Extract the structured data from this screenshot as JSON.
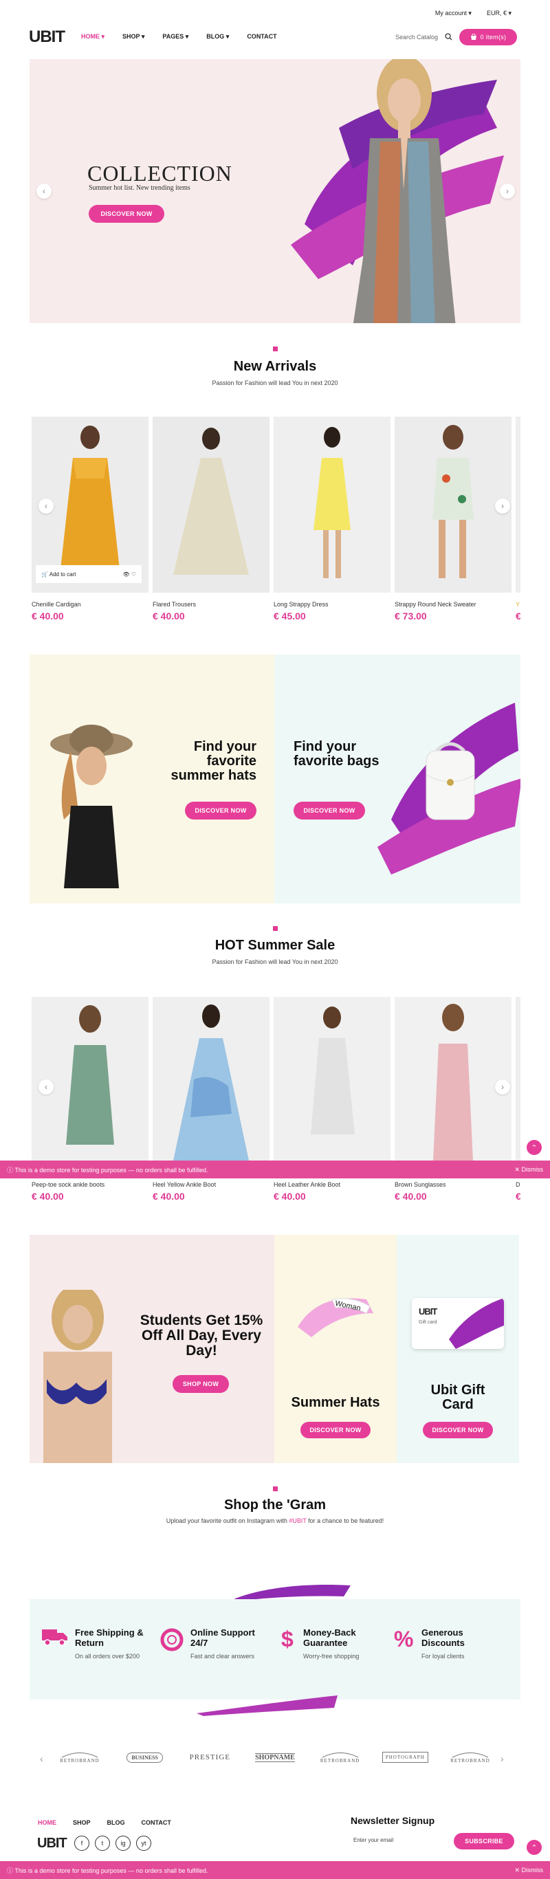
{
  "header": {
    "my_account": "My account",
    "currency": "EUR, €",
    "logo": "UBIT",
    "nav": [
      "HOME",
      "SHOP",
      "PAGES",
      "BLOG",
      "CONTACT"
    ],
    "search_placeholder": "Search Catalog",
    "cart_label": "0 item(s)"
  },
  "hero": {
    "title": "COLLECTION",
    "subtitle": "Summer hot list. New trending items",
    "button": "DISCOVER NOW"
  },
  "new_arrivals": {
    "title": "New Arrivals",
    "subtitle": "Passion for Fashion will lead You in next 2020",
    "add_to_cart": "Add to cart",
    "products": [
      {
        "name": "Chenille Cardigan",
        "price": "€ 40.00"
      },
      {
        "name": "Flared Trousers",
        "price": "€ 40.00"
      },
      {
        "name": "Long Strappy Dress",
        "price": "€ 45.00"
      },
      {
        "name": "Strappy Round Neck Sweater",
        "price": "€ 73.00"
      },
      {
        "name": "Y",
        "price": "€"
      }
    ]
  },
  "banners": {
    "hats": {
      "title": "Find your favorite summer hats",
      "button": "DISCOVER NOW"
    },
    "bags": {
      "title": "Find your favorite bags",
      "button": "DISCOVER NOW"
    }
  },
  "hot_sale": {
    "title": "HOT Summer Sale",
    "subtitle": "Passion for Fashion will lead You in next 2020",
    "products": [
      {
        "name": "Peep-toe sock ankle boots",
        "price": "€ 40.00"
      },
      {
        "name": "Heel Yellow Ankle Boot",
        "price": "€ 40.00"
      },
      {
        "name": "Heel Leather Ankle Boot",
        "price": "€ 40.00"
      },
      {
        "name": "Brown Sunglasses",
        "price": "€ 40.00"
      },
      {
        "name": "D",
        "price": "€"
      }
    ]
  },
  "promo": {
    "text": "This is a demo store for testing purposes — no orders shall be fulfilled.",
    "dismiss": "Dismiss"
  },
  "offers": {
    "students": {
      "title": "Students Get 15% Off All Day, Every Day!",
      "button": "SHOP NOW"
    },
    "hats": {
      "title": "Summer Hats",
      "button": "DISCOVER NOW",
      "visor_text": "Woman"
    },
    "gift": {
      "title": "Ubit Gift Card",
      "button": "DISCOVER NOW",
      "card_logo": "UBIT",
      "card_text": "Gift card"
    }
  },
  "instagram": {
    "title": "Shop the 'Gram",
    "text_before": "Upload your favorite outfit on Instagram with ",
    "hashtag": "#UBIT",
    "text_after": " for a chance to be featured!"
  },
  "features": [
    {
      "title": "Free Shipping & Return",
      "sub": "On all orders over $200",
      "icon": "truck-icon"
    },
    {
      "title": "Online Support 24/7",
      "sub": "Fast and clear answers",
      "icon": "lifebuoy-icon"
    },
    {
      "title": "Money-Back Guarantee",
      "sub": "Worry-free shopping",
      "icon": "dollar-icon"
    },
    {
      "title": "Generous Discounts",
      "sub": "For loyal clients",
      "icon": "percent-icon"
    }
  ],
  "brands": [
    {
      "name": "RETROBRAND"
    },
    {
      "name": "BUSINESS"
    },
    {
      "name": "PRESTIGE"
    },
    {
      "name": "SHOPNAME"
    },
    {
      "name": "RETROBRAND"
    },
    {
      "name": "PHOTOGRAPH"
    },
    {
      "name": "RETROBRAND"
    }
  ],
  "footer": {
    "links": [
      "HOME",
      "SHOP",
      "BLOG",
      "CONTACT"
    ],
    "logo": "UBIT",
    "social": [
      "f",
      "t",
      "ig",
      "yt"
    ],
    "newsletter_title": "Newsletter Signup",
    "email_placeholder": "Enter your email",
    "subscribe": "SUBSCRIBE"
  },
  "colors": {
    "accent": "#e03a93",
    "promo": "#e34b99"
  }
}
